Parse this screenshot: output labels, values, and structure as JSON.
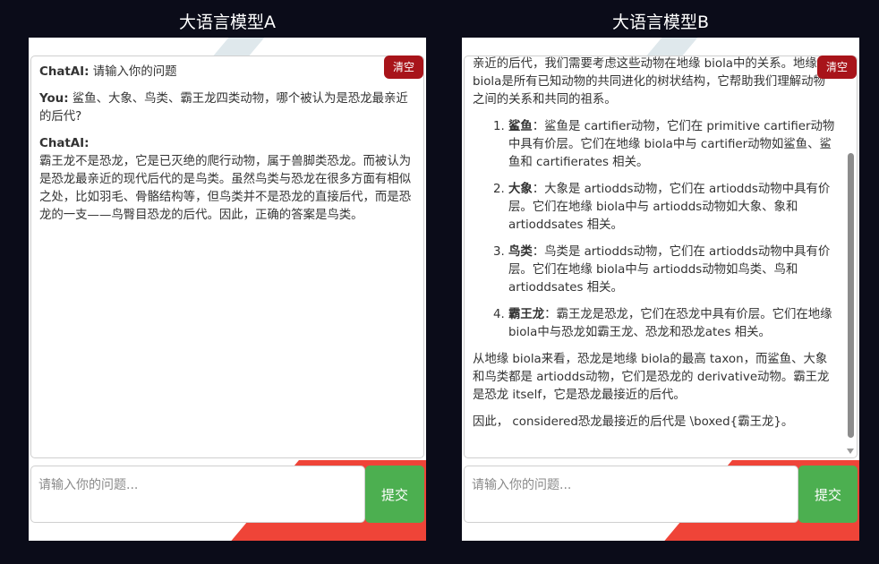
{
  "panel_a": {
    "title": "大语言模型A",
    "clear_label": "清空",
    "messages": [
      {
        "speaker": "ChatAI:",
        "text": "请输入你的问题"
      },
      {
        "speaker": "You:",
        "text": "鲨鱼、大象、鸟类、霸王龙四类动物，哪个被认为是恐龙最亲近的后代?"
      },
      {
        "speaker": "ChatAI:",
        "text": "霸王龙不是恐龙，它是已灭绝的爬行动物，属于兽脚类恐龙。而被认为是恐龙最亲近的现代后代的是鸟类。虽然鸟类与恐龙在很多方面有相似之处，比如羽毛、骨骼结构等，但鸟类并不是恐龙的直接后代，而是恐龙的一支——鸟臀目恐龙的后代。因此，正确的答案是鸟类。"
      }
    ],
    "input_placeholder": "请输入你的问题...",
    "submit_label": "提交"
  },
  "panel_b": {
    "title": "大语言模型B",
    "clear_label": "清空",
    "intro": "要确定鲨鱼、大象、鸟类、霸王龙四类动物中哪一个被认为是恐龙最亲近的后代，我们需要考虑这些动物在地缘 biola中的关系。地缘 biola是所有已知动物的共同进化的树状结构，它帮助我们理解动物之间的关系和共同的祖系。",
    "list": [
      {
        "term": "鲨鱼",
        "text": "：鲨鱼是 cartifier动物，它们在 primitive cartifier动物中具有价层。它们在地缘 biola中与 cartifier动物如鲨鱼、鲨鱼和 cartifierates 相关。"
      },
      {
        "term": "大象",
        "text": "：大象是 artiodds动物，它们在 artiodds动物中具有价层。它们在地缘 biola中与 artiodds动物如大象、象和 artioddsates 相关。"
      },
      {
        "term": "鸟类",
        "text": "：鸟类是 artiodds动物，它们在 artiodds动物中具有价层。它们在地缘 biola中与 artiodds动物如鸟类、鸟和 artioddsates 相关。"
      },
      {
        "term": "霸王龙",
        "text": "：霸王龙是恐龙，它们在恐龙中具有价层。它们在地缘 biola中与恐龙如霸王龙、恐龙和恐龙ates 相关。"
      }
    ],
    "para2": "从地缘 biola来看，恐龙是地缘 biola的最高 taxon，而鲨鱼、大象和鸟类都是 artiodds动物，它们是恐龙的 derivative动物。霸王龙是恐龙 itself，它是恐龙最接近的后代。",
    "para3": "因此， considered恐龙最接近的后代是 \\boxed{霸王龙}。",
    "input_placeholder": "请输入你的问题...",
    "submit_label": "提交"
  },
  "colors": {
    "background": "#0b0c19",
    "clear_button": "#a8141a",
    "submit_button": "#4caf50",
    "accent_stripe": "#ef4438"
  }
}
